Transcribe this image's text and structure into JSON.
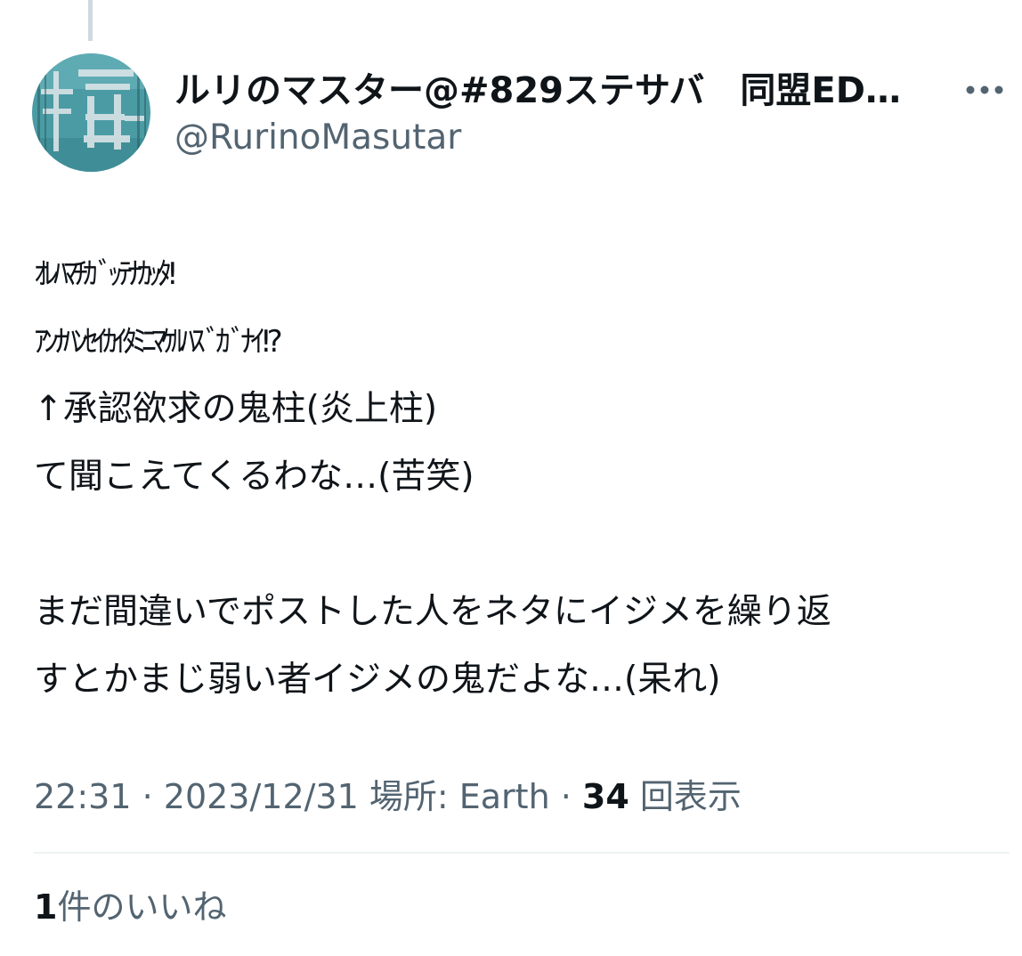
{
  "author": {
    "display_name": "ルリのマスター@#829ステサバ　同盟ED…",
    "handle": "@RurinoMasutar",
    "avatar_icon": "avatar-kanji-stamp-icon"
  },
  "more_icon": "more-horizontal-icon",
  "tweet": {
    "lines": [
      "ｵﾚﾊﾏﾁｶﾞｯﾃﾅｶｯﾀ!",
      "ｱﾝﾅﾊﾝｾｲｶｲﾀﾐﾆﾏｹﾙﾊｽﾞｶﾞﾅｲ!?",
      "↑承認欲求の鬼柱(炎上柱)",
      "て聞こえてくるわな…(苦笑)",
      "",
      "まだ間違いでポストした人をネタにイジメを繰り返",
      "すとかまじ弱い者イジメの鬼だよな…(呆れ)"
    ]
  },
  "meta": {
    "time": "22:31",
    "sep1": " · ",
    "date": "2023/12/31",
    "location_label": " 場所: ",
    "location": "Earth",
    "sep2": " · ",
    "views_count": "34",
    "views_label": " 回表示"
  },
  "likes": {
    "count": "1",
    "label": "件のいいね"
  },
  "colors": {
    "primary_text": "#0f1419",
    "secondary_text": "#536471",
    "divider": "#eff3f4",
    "thread_line": "#cfd9de",
    "avatar_bg": "#4a9ba4"
  }
}
